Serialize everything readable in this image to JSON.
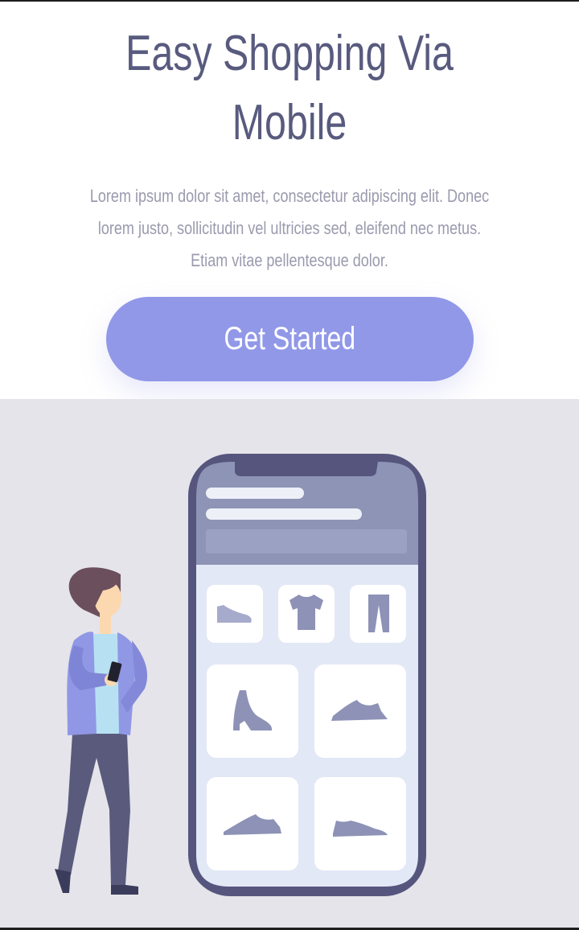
{
  "hero": {
    "title": "Easy Shopping Via Mobile",
    "description": "Lorem ipsum dolor sit amet, consectetur adipiscing elit. Donec lorem justo, sollicitudin vel ultricies sed, eleifend nec metus. Etiam vitae pellentesque dolor.",
    "cta_label": "Get Started"
  },
  "illustration": {
    "icons": [
      "woman-holding-phone-icon",
      "smartphone-icon",
      "sneaker-icon",
      "tshirt-icon",
      "pants-icon",
      "boot-icon",
      "shoe-icon"
    ]
  },
  "colors": {
    "title": "#585a7e",
    "body_text": "#9a9aae",
    "accent": "#9198e8",
    "illustration_bg": "#e5e4ea",
    "phone_frame": "#56557e",
    "product_icon": "#8d92b6"
  }
}
